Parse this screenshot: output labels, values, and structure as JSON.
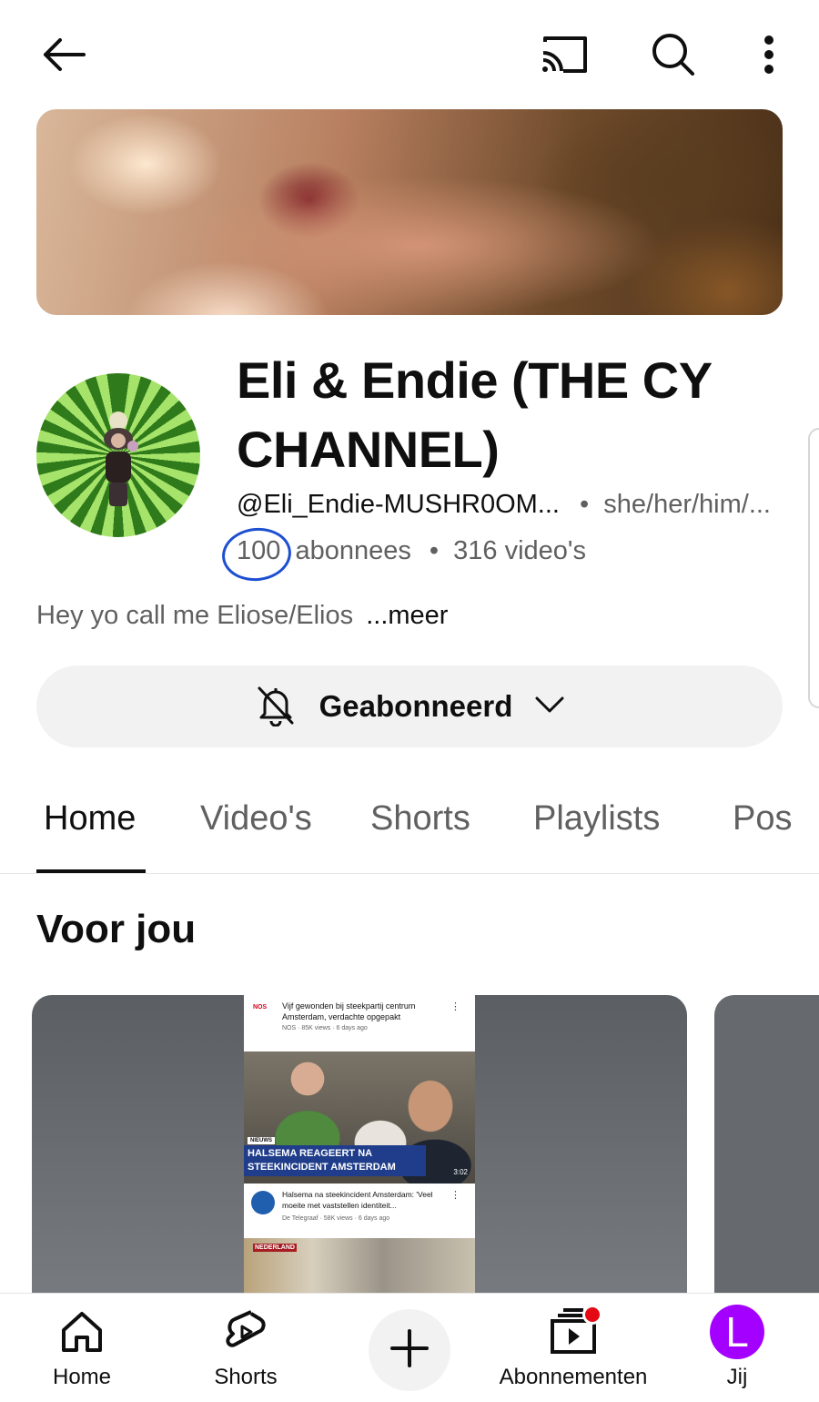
{
  "channel": {
    "name": "Eli & Endie (THE CY CHANNEL)",
    "handle": "@Eli_Endie-MUSHR0OM...",
    "pronouns": "she/her/him/...",
    "subscribers_count": "100",
    "subscribers_label": "abonnees",
    "videos": "316 video's",
    "separator": "•",
    "description": "Hey yo call me Eliose/Elios",
    "more_label": "...meer"
  },
  "subscribe_button": {
    "label": "Geabonneerd"
  },
  "tabs": [
    {
      "label": "Home",
      "active": true
    },
    {
      "label": "Video's",
      "active": false
    },
    {
      "label": "Shorts",
      "active": false
    },
    {
      "label": "Playlists",
      "active": false
    },
    {
      "label": "Pos",
      "active": false
    }
  ],
  "section": {
    "title": "Voor jou"
  },
  "featured_video": {
    "row1": {
      "source": "NOS",
      "title": "Vijf gewonden bij steekpartij centrum Amsterdam, verdachte opgepakt",
      "meta": "NOS · 85K views · 6 days ago"
    },
    "thumb": {
      "tag": "NIEUWS",
      "headline": "HALSEMA REAGEERT NA STEEKINCIDENT AMSTERDAM",
      "duration": "3:02"
    },
    "row3": {
      "title": "Halsema na steekincident Amsterdam: 'Veel moeite met vaststellen identiteit...",
      "meta": "De Telegraaf · 58K views · 6 days ago"
    },
    "row4": {
      "tag": "NEDERLAND"
    },
    "more_dots": "⋮"
  },
  "bottom_nav": {
    "home": "Home",
    "shorts": "Shorts",
    "subscriptions": "Abonnementen",
    "you": "Jij",
    "you_initial": "L"
  },
  "colors": {
    "accent_circle": "#1d4fd1",
    "notification_dot": "#e50914",
    "me_avatar": "#a400ff"
  },
  "icons": [
    "back-arrow-icon",
    "cast-icon",
    "search-icon",
    "more-vert-icon",
    "bell-off-icon",
    "chevron-down-icon",
    "home-icon",
    "shorts-icon",
    "plus-icon",
    "subscriptions-icon"
  ]
}
